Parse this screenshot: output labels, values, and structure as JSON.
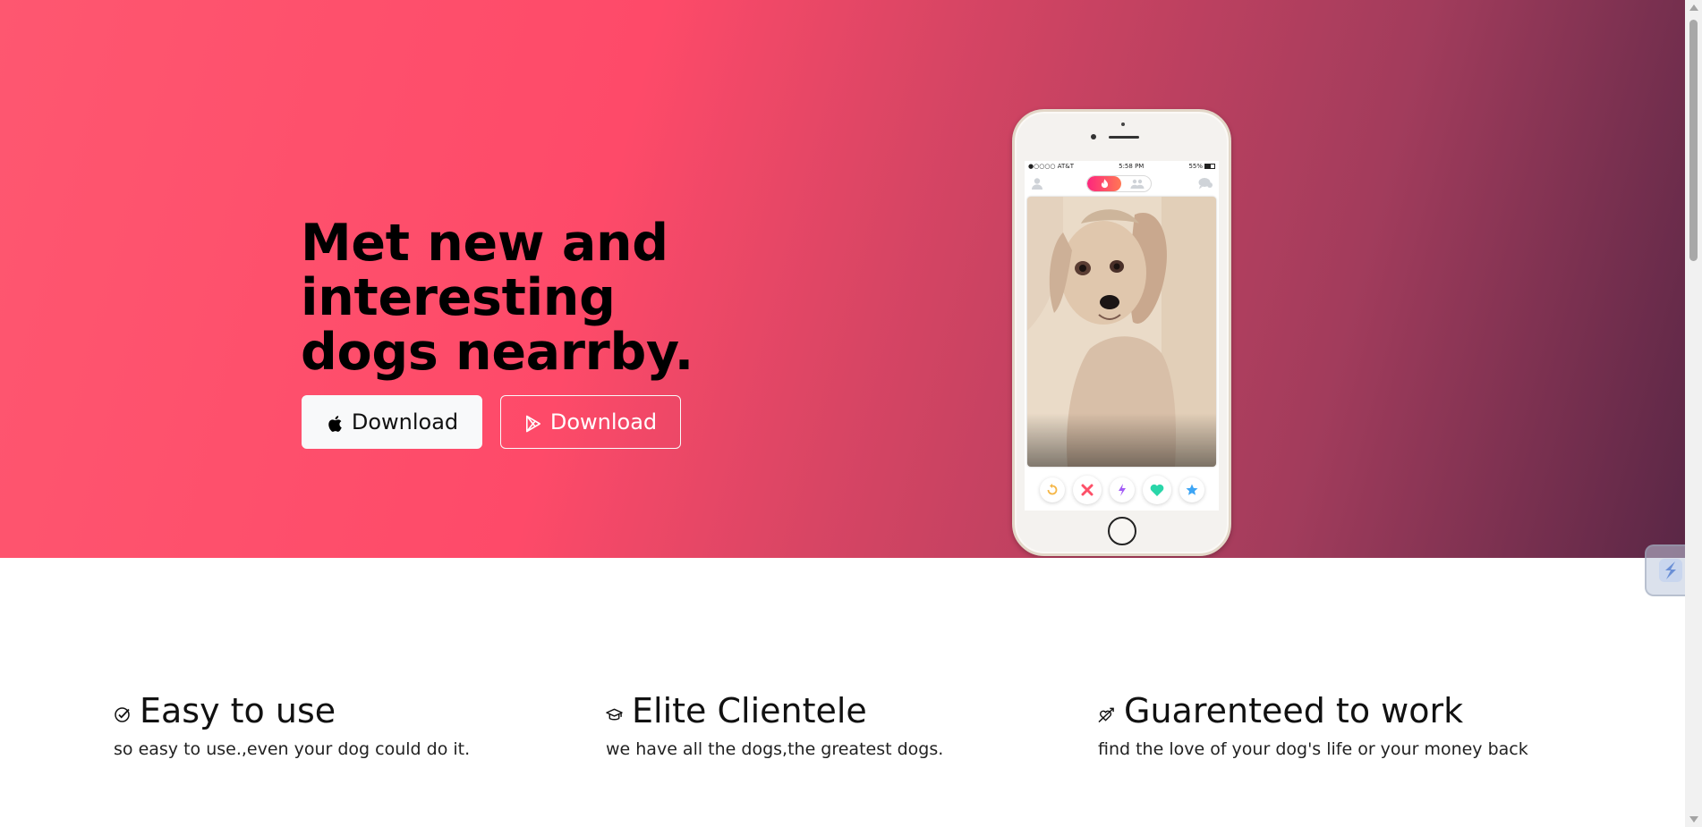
{
  "hero": {
    "title": "Met new and interesting dogs nearrby.",
    "buttons": [
      {
        "label": "Download",
        "icon": "apple-icon",
        "style": "light"
      },
      {
        "label": "Download",
        "icon": "google-play-icon",
        "style": "outline"
      }
    ],
    "gradient_colors": [
      "#fe5770",
      "#fe4a69",
      "#a23c5c",
      "#5a2746"
    ]
  },
  "phone": {
    "status_bar": {
      "carrier": "●○○○○ AT&T",
      "time": "5:58 PM",
      "battery": "55%"
    },
    "actions": [
      "rewind-icon",
      "nope-icon",
      "boost-icon",
      "like-icon",
      "super-like-icon"
    ]
  },
  "features": [
    {
      "icon": "check-circle-icon",
      "title": "Easy to use",
      "text": "so easy to use.,even your dog could do it."
    },
    {
      "icon": "graduation-cap-icon",
      "title": "Elite Clientele",
      "text": "we have all the dogs,the greatest dogs."
    },
    {
      "icon": "heart-arrow-icon",
      "title": "Guarenteed to work",
      "text": "find the love of your dog's life or your money back"
    }
  ]
}
